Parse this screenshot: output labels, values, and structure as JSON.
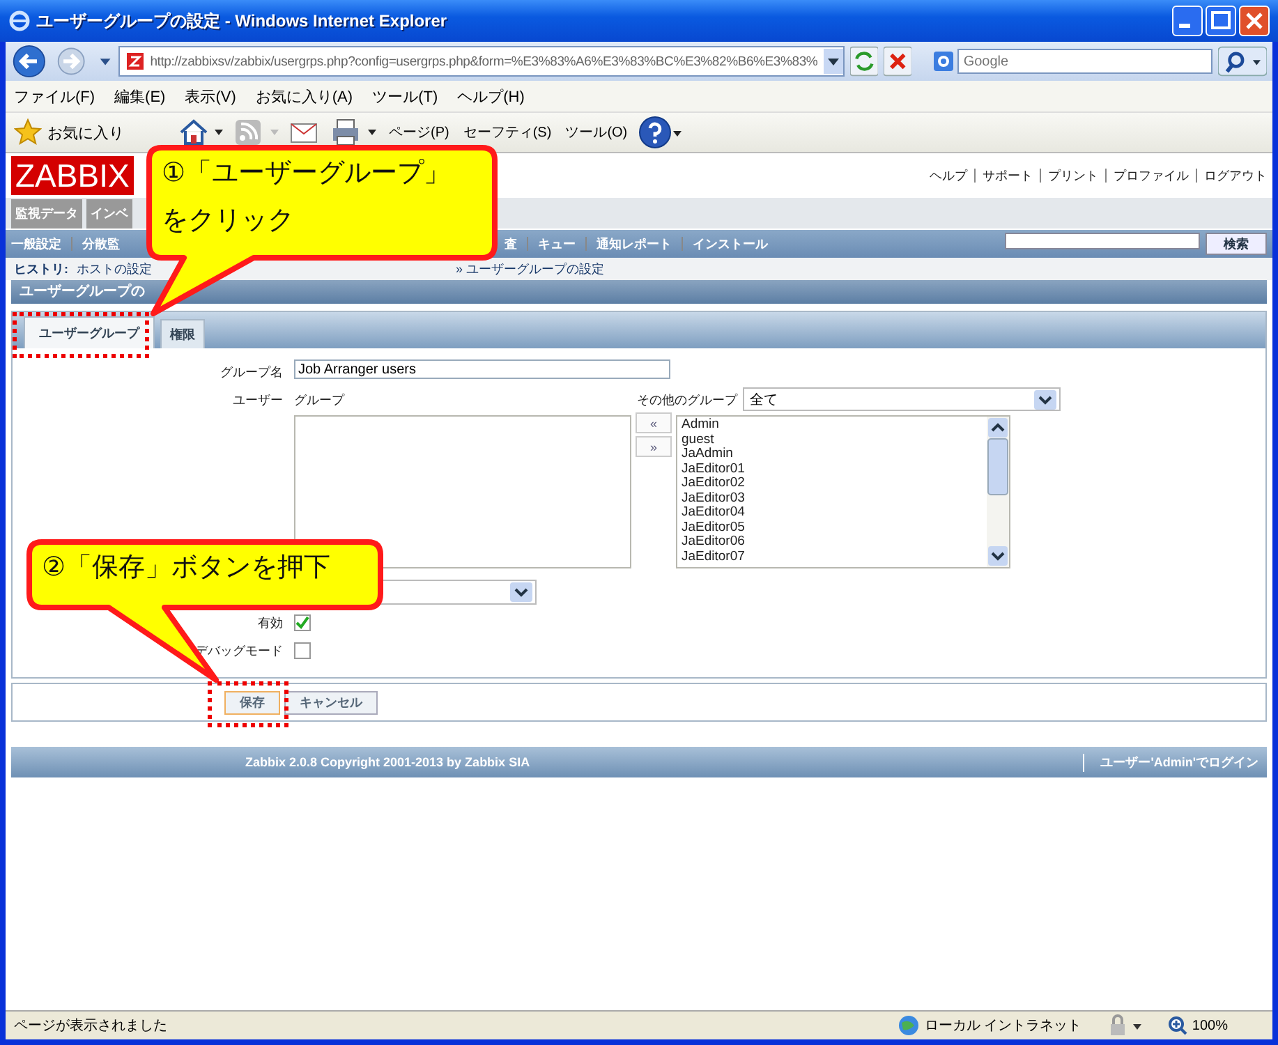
{
  "window": {
    "title": "ユーザーグループの設定 - Windows Internet Explorer",
    "address": "http://zabbixsv/zabbix/usergrps.php?config=usergrps.php&form=%E3%83%A6%E3%83%BC%E3%82%B6%E3%83%",
    "search_placeholder": "Google"
  },
  "menu": [
    "ファイル(F)",
    "編集(E)",
    "表示(V)",
    "お気に入り(A)",
    "ツール(T)",
    "ヘルプ(H)"
  ],
  "toolbar": {
    "favorites": "お気に入り",
    "items": [
      "ページ(P)",
      "セーフティ(S)",
      "ツール(O)"
    ]
  },
  "zabbix": {
    "logo": "ZABBIX",
    "header_links": [
      "ヘルプ",
      "サポート",
      "プリント",
      "プロファイル",
      "ログアウト"
    ],
    "main_tabs": [
      "監視データ",
      "インベ"
    ],
    "nav": [
      "一般設定",
      "分散監"
    ],
    "nav_right": [
      "査",
      "キュー",
      "通知レポート",
      "インストール"
    ],
    "search_button": "検索",
    "history_label": "ヒストリ:",
    "history": [
      "ホストの設定",
      "» ユーザーグループの設定"
    ],
    "section_title": "ユーザーグループの"
  },
  "form": {
    "tabs": [
      {
        "label": "ユーザーグループ",
        "selected": true
      },
      {
        "label": "権限",
        "selected": false
      }
    ],
    "group_name_label": "グループ名",
    "group_name": "Job Arranger users",
    "users_label": "ユーザー",
    "group_label": "グループ",
    "other_groups_label": "その他のグループ",
    "other_groups_value": "全て",
    "move_buttons": [
      "«",
      "»"
    ],
    "users": [
      "Admin",
      "guest",
      "JaAdmin",
      "JaEditor01",
      "JaEditor02",
      "JaEditor03",
      "JaEditor04",
      "JaEditor05",
      "JaEditor06",
      "JaEditor07"
    ],
    "enabled_label": "有効",
    "enabled": true,
    "debug_label": "デバッグモード",
    "debug": false,
    "buttons": [
      "保存",
      "キャンセル"
    ]
  },
  "footer": {
    "copyright": "Zabbix 2.0.8 Copyright 2001-2013 by Zabbix SIA",
    "login": "ユーザー'Admin'でログイン"
  },
  "status_bar": {
    "text": "ページが表示されました",
    "zone": "ローカル イントラネット",
    "zoom": "100%"
  },
  "callouts": [
    {
      "lines": [
        "①「ユーザーグループ」",
        "をクリック"
      ]
    },
    {
      "lines": [
        "②「保存」ボタンを押下"
      ]
    }
  ]
}
